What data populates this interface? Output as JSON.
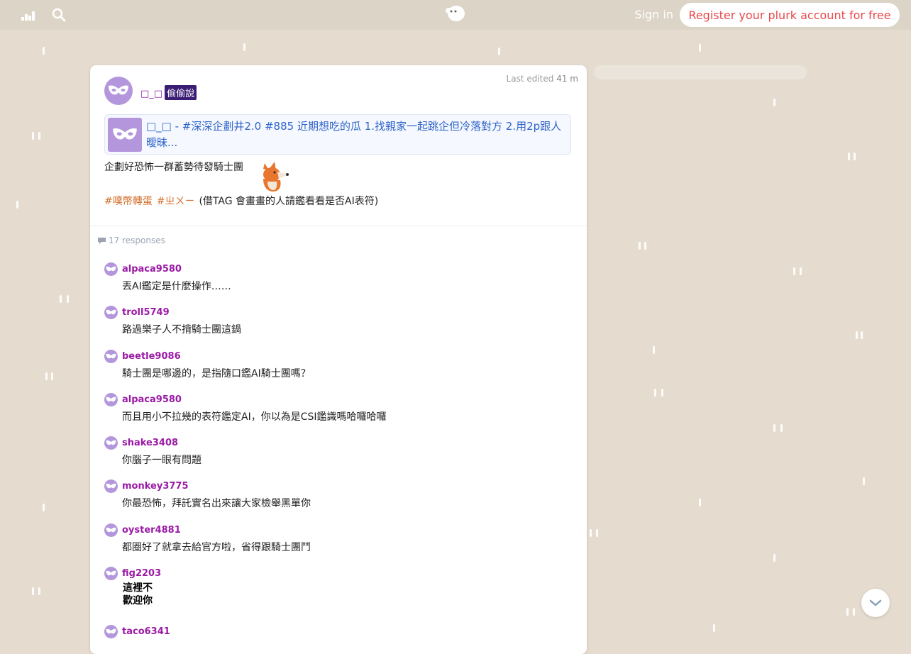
{
  "topbar": {
    "sign_in": "Sign in",
    "register": "Register your plurk account for free",
    "icons": [
      "stats-icon",
      "search-icon",
      "plurk-logo"
    ]
  },
  "plurk": {
    "owner": "□_□",
    "qualifier": "偷偷說",
    "last_edited_label": "Last edited",
    "last_edited_time": "41 m",
    "quote_text": "□_□ - #深深企劃井2.0 #885 近期想吃的瓜 1.找親家一起跳企但冷落對方 2.用2p跟人曖昧...",
    "content_line1": "企劃好恐怖一群蓄勢待發騎士團",
    "tag1": "#噗幣轉蛋",
    "tag2": "#ㄓㄨㄧ",
    "content_line2_rest": "(借TAG 會畫畫的人請鑑看看是否AI表符)",
    "responses_count": "17 responses"
  },
  "responses": [
    {
      "user": "alpaca9580",
      "text": "丟AI鑑定是什麼操作……"
    },
    {
      "user": "troll5749",
      "text": "路過樂子人不揹騎士團這鍋"
    },
    {
      "user": "beetle9086",
      "text": "騎士團是哪邊的，是指隨口鑑AI騎士團嗎？"
    },
    {
      "user": "alpaca9580",
      "text": "而且用小不拉幾的表符鑑定AI，你以為是CSI鑑識嗎哈囉哈囉"
    },
    {
      "user": "shake3408",
      "text": "你腦子一眼有問題"
    },
    {
      "user": "monkey3775",
      "text": "你最恐怖，拜託實名出來讓大家檢舉黑單你"
    },
    {
      "user": "oyster4881",
      "text": "都圈好了就拿去給官方啦，省得跟騎士團鬥"
    },
    {
      "user": "fig2203",
      "text_line1": "這裡不",
      "text_line2": "歡迎你"
    },
    {
      "user": "taco6341",
      "text": ""
    }
  ],
  "colors": {
    "background": "#e5dccf",
    "topbar": "#dcd4c7",
    "register_text": "#e8484a",
    "username": "#9b1aa6",
    "quote_link": "#2f64c8",
    "tag": "#d56f2e",
    "avatar": "#b396dc"
  }
}
